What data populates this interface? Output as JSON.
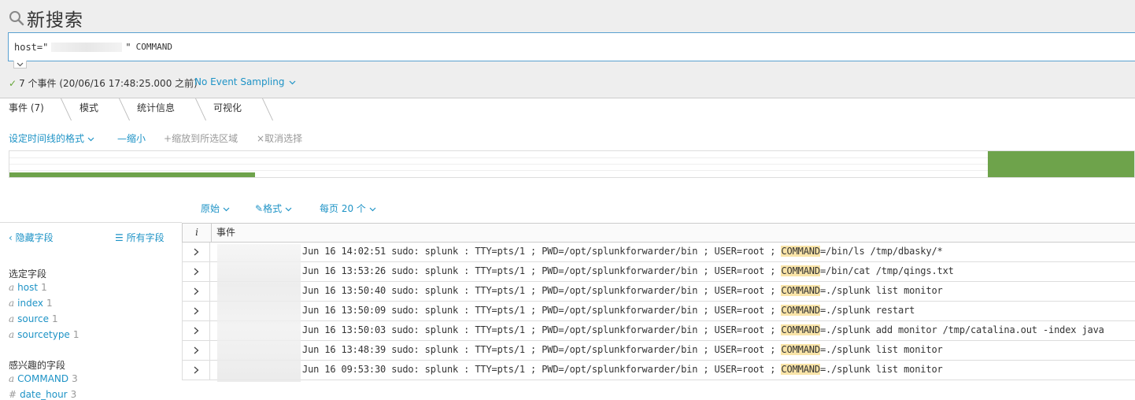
{
  "page": {
    "title": "新搜索"
  },
  "search": {
    "query_prefix": "host=\"",
    "query_suffix": "\"",
    "query_keyword": "COMMAND"
  },
  "status": {
    "events_text": "7 个事件 (20/06/16 17:48:25.000 之前)",
    "sampling_label": "No Event Sampling"
  },
  "tabs": [
    {
      "label": "事件 (7)",
      "active": true
    },
    {
      "label": "模式",
      "active": false
    },
    {
      "label": "统计信息",
      "active": false
    },
    {
      "label": "可视化",
      "active": false
    }
  ],
  "timeline_toolbar": {
    "format_label": "设定时间线的格式",
    "zoom_out_label": "缩小",
    "zoom_to_selection_label": "缩放到所选区域",
    "deselect_label": "取消选择"
  },
  "results_toolbar": {
    "raw_label": "原始",
    "format_label": "格式",
    "per_page_label": "每页 20 个"
  },
  "fields_sidebar": {
    "hide_fields_label": "隐藏字段",
    "all_fields_label": "所有字段",
    "selected_heading": "选定字段",
    "selected_fields": [
      {
        "type": "a",
        "name": "host",
        "count": "1"
      },
      {
        "type": "a",
        "name": "index",
        "count": "1"
      },
      {
        "type": "a",
        "name": "source",
        "count": "1"
      },
      {
        "type": "a",
        "name": "sourcetype",
        "count": "1"
      }
    ],
    "interesting_heading": "感兴趣的字段",
    "interesting_fields": [
      {
        "type": "a",
        "name": "COMMAND",
        "count": "3"
      },
      {
        "type": "#",
        "name": "date_hour",
        "count": "3"
      }
    ]
  },
  "events_table": {
    "header_info": "i",
    "header_event": "事件",
    "rows": [
      {
        "before": "Jun 16 14:02:51 sudo: splunk : TTY=pts/1 ; PWD=/opt/splunkforwarder/bin ; USER=root ; ",
        "field": "COMMAND",
        "after": "=/bin/ls /tmp/dbasky/*"
      },
      {
        "before": "Jun 16 13:53:26 sudo: splunk : TTY=pts/1 ; PWD=/opt/splunkforwarder/bin ; USER=root ; ",
        "field": "COMMAND",
        "after": "=/bin/cat /tmp/qings.txt"
      },
      {
        "before": "Jun 16 13:50:40 sudo: splunk : TTY=pts/1 ; PWD=/opt/splunkforwarder/bin ; USER=root ; ",
        "field": "COMMAND",
        "after": "=./splunk list monitor"
      },
      {
        "before": "Jun 16 13:50:09 sudo: splunk : TTY=pts/1 ; PWD=/opt/splunkforwarder/bin ; USER=root ; ",
        "field": "COMMAND",
        "after": "=./splunk restart"
      },
      {
        "before": "Jun 16 13:50:03 sudo: splunk : TTY=pts/1 ; PWD=/opt/splunkforwarder/bin ; USER=root ; ",
        "field": "COMMAND",
        "after": "=./splunk add monitor /tmp/catalina.out -index java"
      },
      {
        "before": "Jun 16 13:48:39 sudo: splunk : TTY=pts/1 ; PWD=/opt/splunkforwarder/bin ; USER=root ; ",
        "field": "COMMAND",
        "after": "=./splunk list monitor"
      },
      {
        "before": "Jun 16 09:53:30 sudo: splunk : TTY=pts/1 ; PWD=/opt/splunkforwarder/bin ; USER=root ; ",
        "field": "COMMAND",
        "after": "=./splunk list monitor"
      }
    ]
  },
  "colors": {
    "accent": "#1e93c6",
    "timeline_bar": "#6ea34b",
    "highlight": "#f9e4a8",
    "success": "#65a637"
  }
}
